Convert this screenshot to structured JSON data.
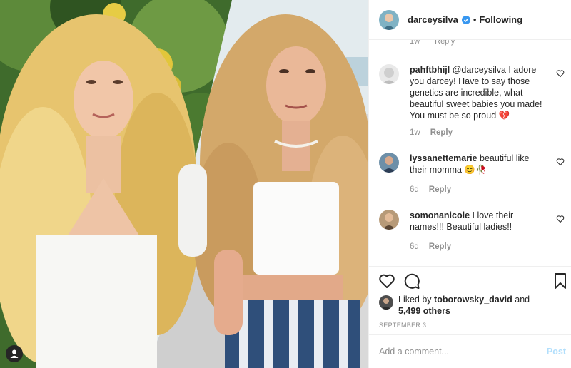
{
  "header": {
    "username": "darceysilva",
    "separator": "•",
    "follow_status": "Following"
  },
  "previous_comment_meta": {
    "time": "1w",
    "reply": "Reply"
  },
  "comments": [
    {
      "username": "pahftbhijl",
      "text": "@darceysilva I adore you darcey! Have to say those genetics are incredible, what beautiful sweet babies you made! You must be so proud",
      "emoji": "💔",
      "time": "1w",
      "reply": "Reply"
    },
    {
      "username": "lyssanettemarie",
      "text": "beautiful like their momma",
      "emoji": "😊🥀",
      "time": "6d",
      "reply": "Reply"
    },
    {
      "username": "somonanicole",
      "text": "I love their names!!! Beautiful ladies!!",
      "emoji": "",
      "time": "6d",
      "reply": "Reply"
    }
  ],
  "likes": {
    "prefix": "Liked by",
    "liker": "toborowsky_david",
    "joiner": "and",
    "others": "5,499 others"
  },
  "post_date": "SEPTEMBER 3",
  "add_comment": {
    "placeholder": "Add a comment...",
    "post_label": "Post"
  },
  "colors": {
    "verified_blue": "#3897f0",
    "post_disabled": "#b2dffc",
    "secondary_text": "#8e8e8e",
    "primary_text": "#262626"
  },
  "icons": [
    "verified-badge-icon",
    "heart-icon",
    "comment-icon",
    "bookmark-icon",
    "user-tag-icon"
  ]
}
